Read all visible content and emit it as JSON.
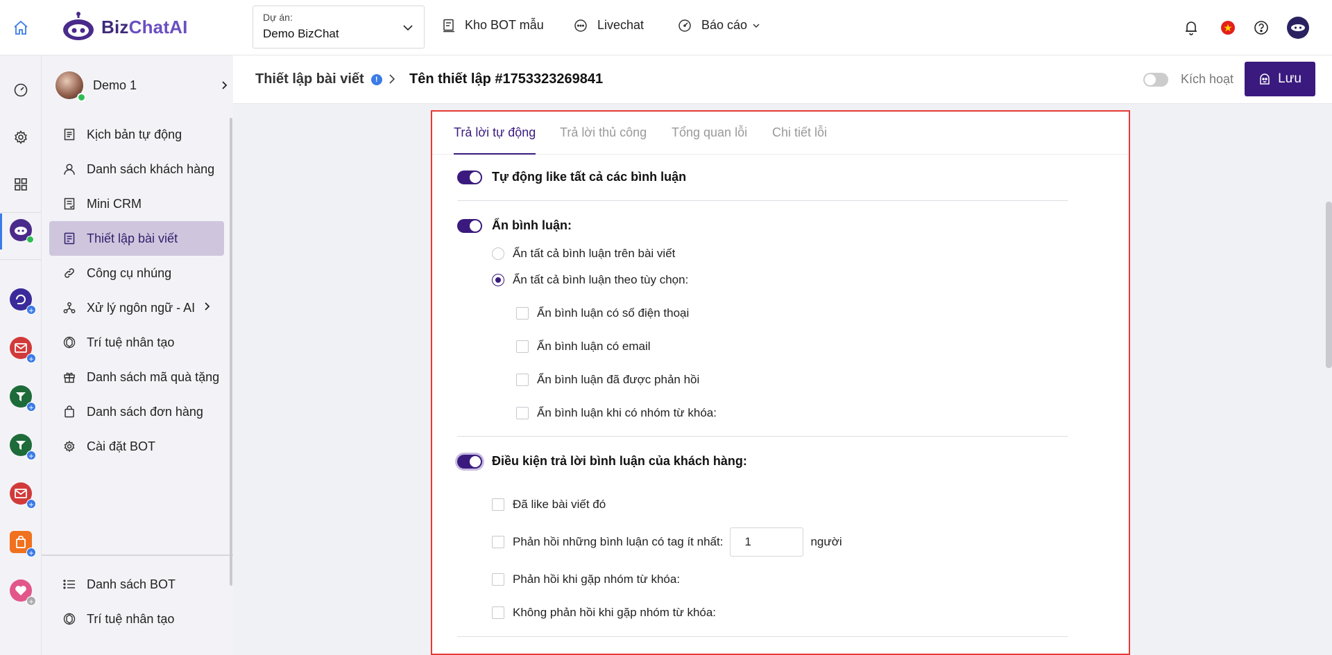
{
  "brand": {
    "name_part1": "Biz",
    "name_part2": "ChatAI"
  },
  "project": {
    "label": "Dự án:",
    "value": "Demo BizChat"
  },
  "topnav": {
    "bot_store": "Kho BOT mẫu",
    "livechat": "Livechat",
    "report": "Báo cáo"
  },
  "header_icons": {
    "notification": "bell-icon",
    "language": "vn-flag-icon",
    "help": "help-icon",
    "profile": "profile-avatar-icon"
  },
  "user": {
    "name": "Demo 1"
  },
  "menu": {
    "items": [
      {
        "label": "Kịch bản tự động",
        "icon": "script-icon"
      },
      {
        "label": "Danh sách khách hàng",
        "icon": "user-icon"
      },
      {
        "label": "Mini CRM",
        "icon": "crm-icon"
      },
      {
        "label": "Thiết lập bài viết",
        "icon": "post-icon"
      },
      {
        "label": "Công cụ nhúng",
        "icon": "link-icon"
      },
      {
        "label": "Xử lý ngôn ngữ - AI",
        "icon": "nlp-icon"
      },
      {
        "label": "Trí tuệ nhân tạo",
        "icon": "ai-icon"
      },
      {
        "label": "Danh sách mã quà tặng",
        "icon": "gift-icon"
      },
      {
        "label": "Danh sách đơn hàng",
        "icon": "bag-icon"
      },
      {
        "label": "Cài đặt BOT",
        "icon": "gear-icon"
      }
    ],
    "bottom": [
      {
        "label": "Danh sách BOT",
        "icon": "list-icon"
      },
      {
        "label": "Trí tuệ nhân tạo",
        "icon": "ai-icon"
      }
    ]
  },
  "breadcrumb": {
    "parent": "Thiết lập bài viết",
    "current": "Tên thiết lập #1753323269841"
  },
  "activate_label": "Kích hoạt",
  "save_label": "Lưu",
  "tabs": [
    "Trả lời tự động",
    "Trả lời thủ công",
    "Tổng quan lỗi",
    "Chi tiết lỗi"
  ],
  "settings": {
    "auto_like": "Tự động like tất cả các bình luận",
    "hide_comments": {
      "title": "Ẩn bình luận:",
      "radio_all": "Ẩn tất cả bình luận trên bài viết",
      "radio_custom": "Ẩn tất cả bình luận theo tùy chọn:",
      "cb_phone": "Ẩn bình luận có số điện thoại",
      "cb_email": "Ẩn bình luận có email",
      "cb_replied": "Ẩn bình luận đã được phản hồi",
      "cb_keyword": "Ẩn bình luận khi có nhóm từ khóa:"
    },
    "reply_conditions": {
      "title": "Điều kiện trả lời bình luận của khách hàng:",
      "cb_liked": "Đã like bài viết đó",
      "cb_tag_prefix": "Phản hồi những bình luận có tag ít nhất:",
      "tag_value": "1",
      "cb_tag_suffix": "người",
      "cb_keyword": "Phản hồi khi gặp nhóm từ khóa:",
      "cb_no_keyword": "Không phản hồi khi gặp nhóm từ khóa:"
    }
  },
  "colors": {
    "primary": "#3a1a7e",
    "highlight": "#e53935",
    "active_menu": "#cfc6de"
  }
}
